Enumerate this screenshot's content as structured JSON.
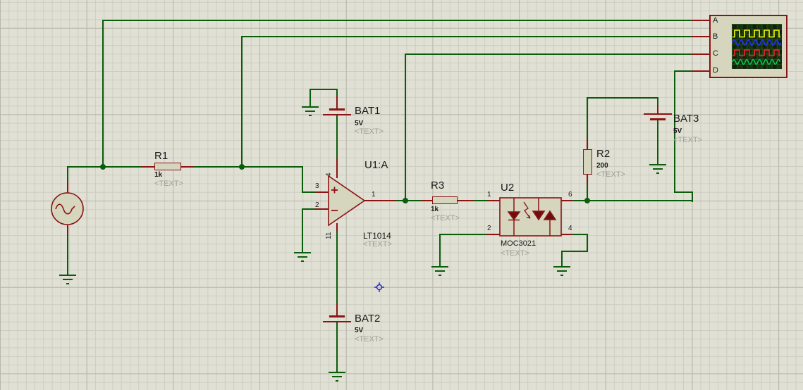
{
  "colors": {
    "wire_green": "#0B5C0B",
    "component_outline": "#8B1414",
    "component_fill": "#D6D6BE",
    "canvas_background": "#E0E0D4",
    "origin_marker_blue": "#2626C9",
    "placeholder_gray": "#A0A098"
  },
  "components": {
    "r1": {
      "ref": "R1",
      "value": "1k",
      "text_placeholder": "<TEXT>"
    },
    "r2": {
      "ref": "R2",
      "value": "200",
      "text_placeholder": "<TEXT>"
    },
    "r3": {
      "ref": "R3",
      "value": "1k",
      "text_placeholder": "<TEXT>"
    },
    "bat1": {
      "ref": "BAT1",
      "value": "5V",
      "text_placeholder": "<TEXT>"
    },
    "bat2": {
      "ref": "BAT2",
      "value": "5V",
      "text_placeholder": "<TEXT>"
    },
    "bat3": {
      "ref": "BAT3",
      "value": "5V",
      "text_placeholder": "<TEXT>"
    },
    "opamp": {
      "ref": "U1:A",
      "part": "LT1014",
      "text_placeholder": "<TEXT>",
      "pin_noninv": "3",
      "pin_inv": "2",
      "pin_out": "1",
      "pin_vplus": "4",
      "pin_vminus": "11"
    },
    "u2": {
      "ref": "U2",
      "part": "MOC3021",
      "text_placeholder": "<TEXT>",
      "pin1": "1",
      "pin2": "2",
      "pin6": "6",
      "pin4": "4"
    },
    "scope": {
      "channels": [
        {
          "label": "A",
          "waveform": "square",
          "color": "#FFFF00"
        },
        {
          "label": "B",
          "waveform": "sine",
          "color": "#2233FF"
        },
        {
          "label": "C",
          "waveform": "square",
          "color": "#FF2222"
        },
        {
          "label": "D",
          "waveform": "sine",
          "color": "#00D455"
        }
      ]
    }
  }
}
